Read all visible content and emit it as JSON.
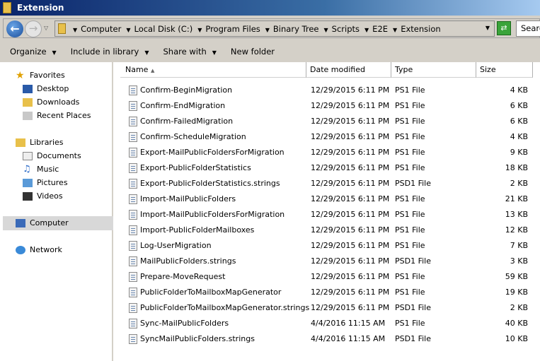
{
  "window": {
    "title": "Extension"
  },
  "address": {
    "crumbs": [
      "Computer",
      "Local Disk (C:)",
      "Program Files",
      "Binary Tree",
      "Scripts",
      "E2E",
      "Extension"
    ],
    "search_placeholder": "Search"
  },
  "toolbar": {
    "organize": "Organize",
    "include": "Include in library",
    "share": "Share with",
    "new_folder": "New folder"
  },
  "sidebar": {
    "favorites": "Favorites",
    "fav_items": [
      "Desktop",
      "Downloads",
      "Recent Places"
    ],
    "libraries": "Libraries",
    "lib_items": [
      "Documents",
      "Music",
      "Pictures",
      "Videos"
    ],
    "computer": "Computer",
    "network": "Network"
  },
  "columns": {
    "name": "Name",
    "date": "Date modified",
    "type": "Type",
    "size": "Size"
  },
  "files": [
    {
      "name": "Confirm-BeginMigration",
      "date": "12/29/2015 6:11 PM",
      "type": "PS1 File",
      "size": "4 KB"
    },
    {
      "name": "Confirm-EndMigration",
      "date": "12/29/2015 6:11 PM",
      "type": "PS1 File",
      "size": "6 KB"
    },
    {
      "name": "Confirm-FailedMigration",
      "date": "12/29/2015 6:11 PM",
      "type": "PS1 File",
      "size": "6 KB"
    },
    {
      "name": "Confirm-ScheduleMigration",
      "date": "12/29/2015 6:11 PM",
      "type": "PS1 File",
      "size": "4 KB"
    },
    {
      "name": "Export-MailPublicFoldersForMigration",
      "date": "12/29/2015 6:11 PM",
      "type": "PS1 File",
      "size": "9 KB"
    },
    {
      "name": "Export-PublicFolderStatistics",
      "date": "12/29/2015 6:11 PM",
      "type": "PS1 File",
      "size": "18 KB"
    },
    {
      "name": "Export-PublicFolderStatistics.strings",
      "date": "12/29/2015 6:11 PM",
      "type": "PSD1 File",
      "size": "2 KB"
    },
    {
      "name": "Import-MailPublicFolders",
      "date": "12/29/2015 6:11 PM",
      "type": "PS1 File",
      "size": "21 KB"
    },
    {
      "name": "Import-MailPublicFoldersForMigration",
      "date": "12/29/2015 6:11 PM",
      "type": "PS1 File",
      "size": "13 KB"
    },
    {
      "name": "Import-PublicFolderMailboxes",
      "date": "12/29/2015 6:11 PM",
      "type": "PS1 File",
      "size": "12 KB"
    },
    {
      "name": "Log-UserMigration",
      "date": "12/29/2015 6:11 PM",
      "type": "PS1 File",
      "size": "7 KB"
    },
    {
      "name": "MailPublicFolders.strings",
      "date": "12/29/2015 6:11 PM",
      "type": "PSD1 File",
      "size": "3 KB"
    },
    {
      "name": "Prepare-MoveRequest",
      "date": "12/29/2015 6:11 PM",
      "type": "PS1 File",
      "size": "59 KB"
    },
    {
      "name": "PublicFolderToMailboxMapGenerator",
      "date": "12/29/2015 6:11 PM",
      "type": "PS1 File",
      "size": "19 KB"
    },
    {
      "name": "PublicFolderToMailboxMapGenerator.strings",
      "date": "12/29/2015 6:11 PM",
      "type": "PSD1 File",
      "size": "2 KB"
    },
    {
      "name": "Sync-MailPublicFolders",
      "date": "4/4/2016 11:15 AM",
      "type": "PS1 File",
      "size": "40 KB"
    },
    {
      "name": "SyncMailPublicFolders.strings",
      "date": "4/4/2016 11:15 AM",
      "type": "PSD1 File",
      "size": "10 KB"
    }
  ]
}
